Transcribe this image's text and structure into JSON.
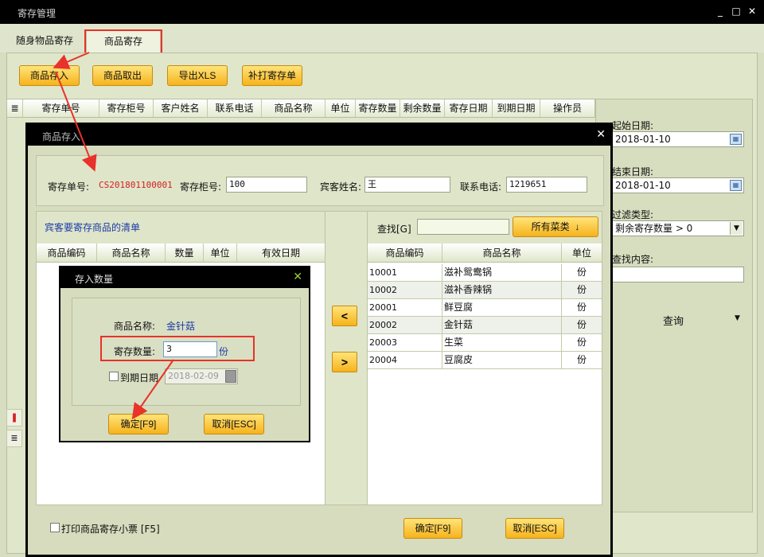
{
  "window": {
    "title": "寄存管理"
  },
  "tabs": [
    {
      "label": "随身物品寄存"
    },
    {
      "label": "商品寄存"
    }
  ],
  "toolbar": {
    "store_label": "商品存入",
    "retrieve_label": "商品取出",
    "export_label": "导出XLS",
    "reprint_label": "补打寄存单"
  },
  "grid": {
    "headers": [
      "寄存单号",
      "寄存柜号",
      "客户姓名",
      "联系电话",
      "商品名称",
      "单位",
      "寄存数量",
      "剩余数量",
      "寄存日期",
      "到期日期",
      "操作员"
    ]
  },
  "filters": {
    "start_label": "起始日期:",
    "start_value": "2018-01-10",
    "end_label": "结束日期:",
    "end_value": "2018-01-10",
    "type_label": "过滤类型:",
    "type_value": "剩余寄存数量 > 0",
    "content_label": "查找内容:",
    "content_value": "",
    "query_label": "查询"
  },
  "dialog": {
    "title": "商品存入",
    "order_label": "寄存单号:",
    "order_value": "CS201801100001",
    "cabinet_label": "寄存柜号:",
    "cabinet_value": "100",
    "guest_label": "宾客姓名:",
    "guest_value": "王",
    "phone_label": "联系电话:",
    "phone_value": "1219651",
    "list_title": "宾客要寄存商品的清单",
    "list_headers": [
      "商品编码",
      "商品名称",
      "数量",
      "单位",
      "有效日期"
    ],
    "search_label": "查找[G]",
    "search_value": "",
    "category_label": "所有菜类",
    "product_headers": [
      "商品编码",
      "商品名称",
      "单位"
    ],
    "products": [
      {
        "code": "10001",
        "name": "滋补鸳鸯锅",
        "unit": "份"
      },
      {
        "code": "10002",
        "name": "滋补香辣锅",
        "unit": "份"
      },
      {
        "code": "20001",
        "name": "鲜豆腐",
        "unit": "份"
      },
      {
        "code": "20002",
        "name": "金针菇",
        "unit": "份"
      },
      {
        "code": "20003",
        "name": "生菜",
        "unit": "份"
      },
      {
        "code": "20004",
        "name": "豆腐皮",
        "unit": "份"
      }
    ],
    "move_left": "<",
    "move_right": ">",
    "print_label": "打印商品寄存小票 [F5]",
    "ok_label": "确定[F9]",
    "cancel_label": "取消[ESC]"
  },
  "qty_dialog": {
    "title": "存入数量",
    "name_label": "商品名称:",
    "name_value": "金针菇",
    "qty_label": "寄存数量:",
    "qty_value": "3",
    "unit": "份",
    "expire_label": "到期日期",
    "expire_value": "2018-02-09",
    "ok_label": "确定[F9]",
    "cancel_label": "取消[ESC]"
  },
  "colors": {
    "accent": "#f6b31c",
    "annotation": "#e8322a",
    "order_no": "#d42020",
    "link_blue": "#1a3aa8"
  },
  "icons": [
    "list-icon",
    "calendar-icon",
    "close-icon",
    "down-arrow-icon",
    "maximize-icon",
    "minimize-icon"
  ]
}
